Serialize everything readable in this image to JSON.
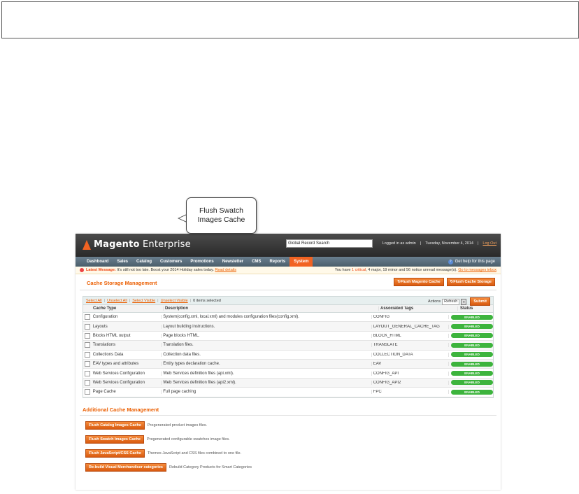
{
  "app": {
    "brand_main": "Magento",
    "brand_sub": "Enterprise",
    "search_value": "Global Record Search",
    "logged_in": "Logged in as admin",
    "date": "Tuesday, November 4, 2014",
    "logout": "Log Out",
    "help": "Get help for this page"
  },
  "nav": [
    "Dashboard",
    "Sales",
    "Catalog",
    "Customers",
    "Promotions",
    "Newsletter",
    "CMS",
    "Reports",
    "System"
  ],
  "nav_active": "System",
  "message": {
    "label": "Latest Message:",
    "text": "It's still not too late. Boost your 2014 Holiday sales today.",
    "link": "Read details",
    "right_prefix": "You have",
    "critical": "1 critical",
    "right_rest": ", 4 major, 19 minor and 56 notice unread message(s).",
    "right_link": "Go to messages inbox"
  },
  "page": {
    "title": "Cache Storage Management",
    "flush_magento": "Flush Magento Cache",
    "flush_storage": "Flush Cache Storage"
  },
  "massbar": {
    "select_all": "Select All",
    "unselect_all": "Unselect All",
    "select_visible": "Select Visible",
    "unselect_visible": "Unselect Visible",
    "selected": "0 items selected",
    "actions_label": "Actions",
    "action_value": "Refresh",
    "submit": "Submit"
  },
  "grid": {
    "headers": [
      "Cache Type",
      "Description",
      "Associated Tags",
      "Status"
    ],
    "rows": [
      {
        "type": "Configuration",
        "desc": "System(config.xml, local.xml) and modules configuration files(config.xml).",
        "tags": "CONFIG",
        "status": "ENABLED"
      },
      {
        "type": "Layouts",
        "desc": "Layout building instructions.",
        "tags": "LAYOUT_GENERAL_CACHE_TAG",
        "status": "ENABLED"
      },
      {
        "type": "Blocks HTML output",
        "desc": "Page blocks HTML.",
        "tags": "BLOCK_HTML",
        "status": "ENABLED"
      },
      {
        "type": "Translations",
        "desc": "Translation files.",
        "tags": "TRANSLATE",
        "status": "ENABLED"
      },
      {
        "type": "Collections Data",
        "desc": "Collection data files.",
        "tags": "COLLECTION_DATA",
        "status": "ENABLED"
      },
      {
        "type": "EAV types and attributes",
        "desc": "Entity types declaration cache.",
        "tags": "EAV",
        "status": "ENABLED"
      },
      {
        "type": "Web Services Configuration",
        "desc": "Web Services definition files (api.xml).",
        "tags": "CONFIG_API",
        "status": "ENABLED"
      },
      {
        "type": "Web Services Configuration",
        "desc": "Web Services definition files (api2.xml).",
        "tags": "CONFIG_API2",
        "status": "ENABLED"
      },
      {
        "type": "Page Cache",
        "desc": "Full page caching",
        "tags": "FPC",
        "status": "ENABLED"
      }
    ]
  },
  "additional": {
    "title": "Additional Cache Management",
    "items": [
      {
        "button": "Flush Catalog Images Cache",
        "desc": "Pregenerated product images files."
      },
      {
        "button": "Flush Swatch Images Cache",
        "desc": "Pregenerated configurable swatches image files."
      },
      {
        "button": "Flush JavaScript/CSS Cache",
        "desc": "Themes JavaScript and CSS files combined to one file."
      },
      {
        "button": "Re-build Visual Merchandiser categories",
        "desc": "Rebuild Category Products for Smart Categories"
      }
    ]
  },
  "callout": {
    "line1": "Flush Swatch",
    "line2": "Images Cache"
  }
}
